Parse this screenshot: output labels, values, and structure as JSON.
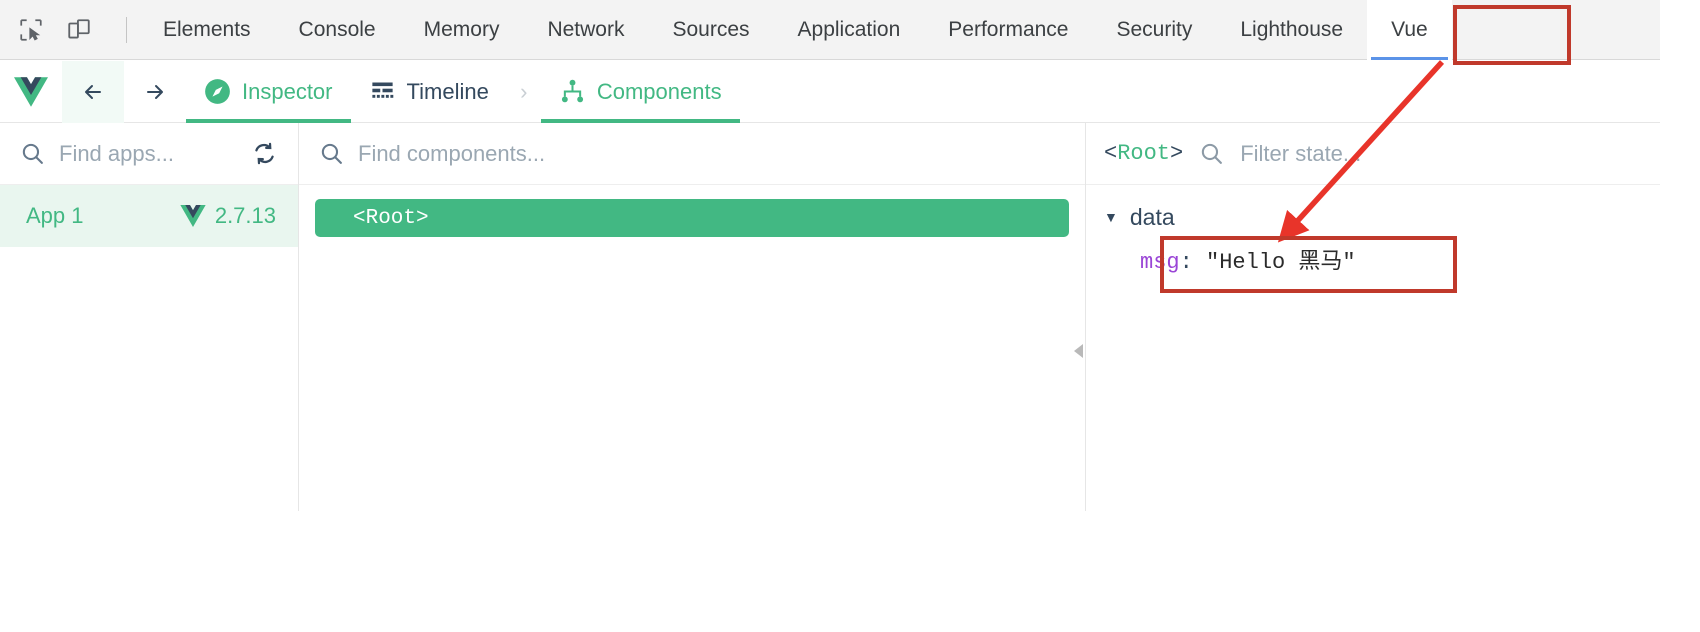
{
  "devtools": {
    "icons": {
      "inspect_element": "cursor-select-icon",
      "device_toolbar": "device-toggle-icon"
    },
    "tabs": [
      {
        "label": "Elements",
        "active": false
      },
      {
        "label": "Console",
        "active": false
      },
      {
        "label": "Memory",
        "active": false
      },
      {
        "label": "Network",
        "active": false
      },
      {
        "label": "Sources",
        "active": false
      },
      {
        "label": "Application",
        "active": false
      },
      {
        "label": "Performance",
        "active": false
      },
      {
        "label": "Security",
        "active": false
      },
      {
        "label": "Lighthouse",
        "active": false
      },
      {
        "label": "Vue",
        "active": true
      }
    ]
  },
  "vue_toolbar": {
    "logo_icon": "vue-logo-icon",
    "back_label": "back-arrow-icon",
    "forward_label": "forward-arrow-icon",
    "items": [
      {
        "label": "Inspector",
        "icon": "compass-icon",
        "active": true
      },
      {
        "label": "Timeline",
        "icon": "timeline-icon",
        "active": false
      }
    ],
    "separator": "›",
    "breadcrumb": {
      "label": "Components",
      "icon": "component-tree-icon",
      "active": true
    }
  },
  "apps_pane": {
    "search": {
      "placeholder": "Find apps...",
      "value": "",
      "icon": "search-icon"
    },
    "refresh_icon": "refresh-icon",
    "apps": [
      {
        "name": "App 1",
        "version": "2.7.13",
        "icon": "vue-logo-icon",
        "selected": true
      }
    ]
  },
  "components_pane": {
    "search": {
      "placeholder": "Find components...",
      "value": "",
      "icon": "search-icon"
    },
    "tree": [
      {
        "label": "<Root>",
        "selected": true
      }
    ],
    "collapse_handle_icon": "collapse-left-icon"
  },
  "state_pane": {
    "component": {
      "open": "<",
      "name": "Root",
      "close": ">"
    },
    "search": {
      "placeholder": "Filter state...",
      "value": "",
      "icon": "search-icon"
    },
    "groups": [
      {
        "caret": "▼",
        "label": "data",
        "entries": [
          {
            "key": "msg",
            "separator": ": ",
            "value": "\"Hello 黑马\""
          }
        ]
      }
    ]
  },
  "annotations": {
    "highlight_color": "#c0392b",
    "boxes": [
      {
        "target": "vue-tab"
      },
      {
        "target": "state-entry-msg"
      }
    ],
    "arrow": {
      "from": "vue-tab",
      "to": "state-entry-msg"
    }
  },
  "colors": {
    "vue_green": "#42b883",
    "devtools_bg": "#f3f3f3",
    "text": "#34495e",
    "active_tab_underline": "#5b93e8",
    "key_purple": "#9a45d6",
    "annotation_red": "#c0392b"
  }
}
